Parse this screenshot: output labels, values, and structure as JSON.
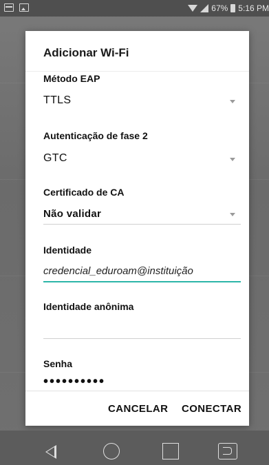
{
  "status_bar": {
    "battery": "67%",
    "time": "5:16 PM",
    "icons": [
      "window-icon",
      "image-icon",
      "wifi-icon",
      "signal-icon",
      "battery-icon"
    ]
  },
  "dialog": {
    "title": "Adicionar Wi-Fi",
    "fields": {
      "eap_method": {
        "label": "Método EAP",
        "value": "TTLS"
      },
      "phase2": {
        "label": "Autenticação de fase 2",
        "value": "GTC"
      },
      "ca_cert": {
        "label": "Certificado de CA",
        "value": "Não validar"
      },
      "identity": {
        "label": "Identidade",
        "value": "credencial_eduroam@instituição"
      },
      "anonymous_identity": {
        "label": "Identidade anônima",
        "value": ""
      },
      "password": {
        "label": "Senha",
        "value": "••••••••••"
      }
    },
    "buttons": {
      "cancel": "CANCELAR",
      "connect": "CONECTAR"
    }
  },
  "nav_bar": {
    "icons": [
      "back-icon",
      "home-icon",
      "recents-icon",
      "dual-window-icon"
    ]
  },
  "colors": {
    "accent": "#2bb5a8",
    "dialog_bg": "#ffffff",
    "backdrop": "#6f6f6f"
  }
}
